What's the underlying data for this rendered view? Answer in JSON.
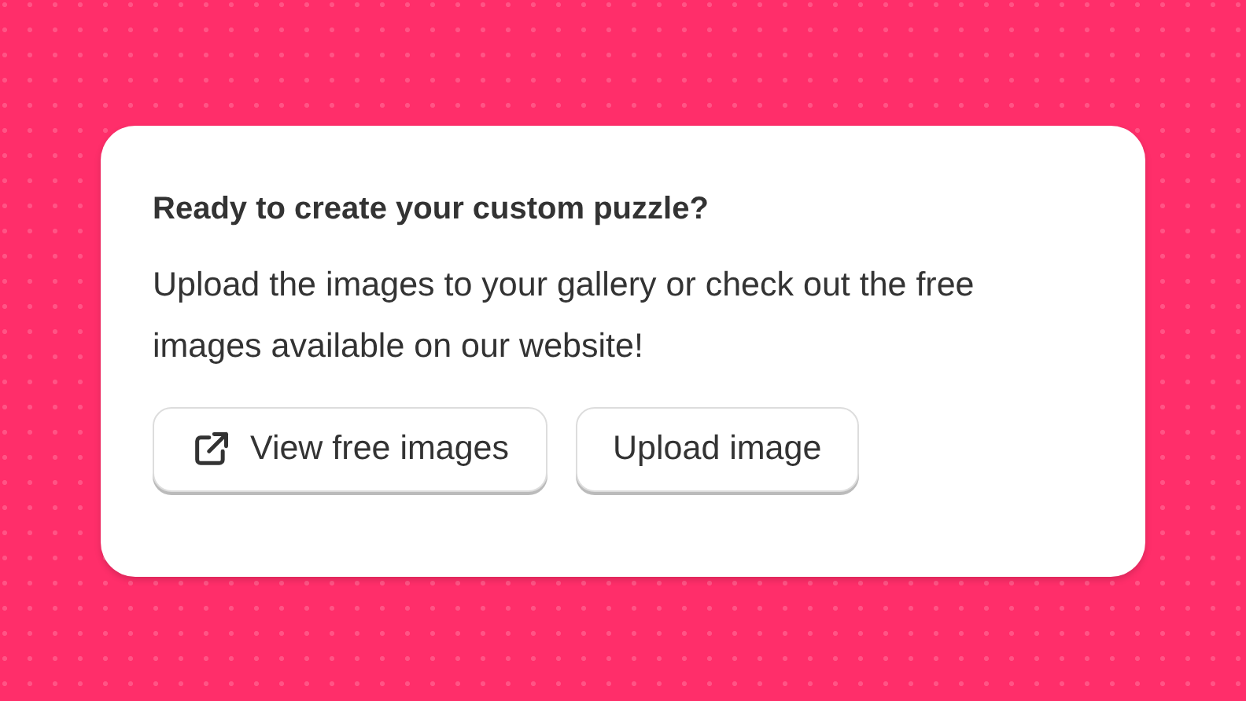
{
  "card": {
    "title": "Ready to create your custom puzzle?",
    "body": "Upload the images to your gallery or check out the free images available on our website!",
    "buttons": [
      {
        "label": "View free images",
        "kind": "external"
      },
      {
        "label": "Upload image",
        "kind": "plain"
      }
    ]
  }
}
